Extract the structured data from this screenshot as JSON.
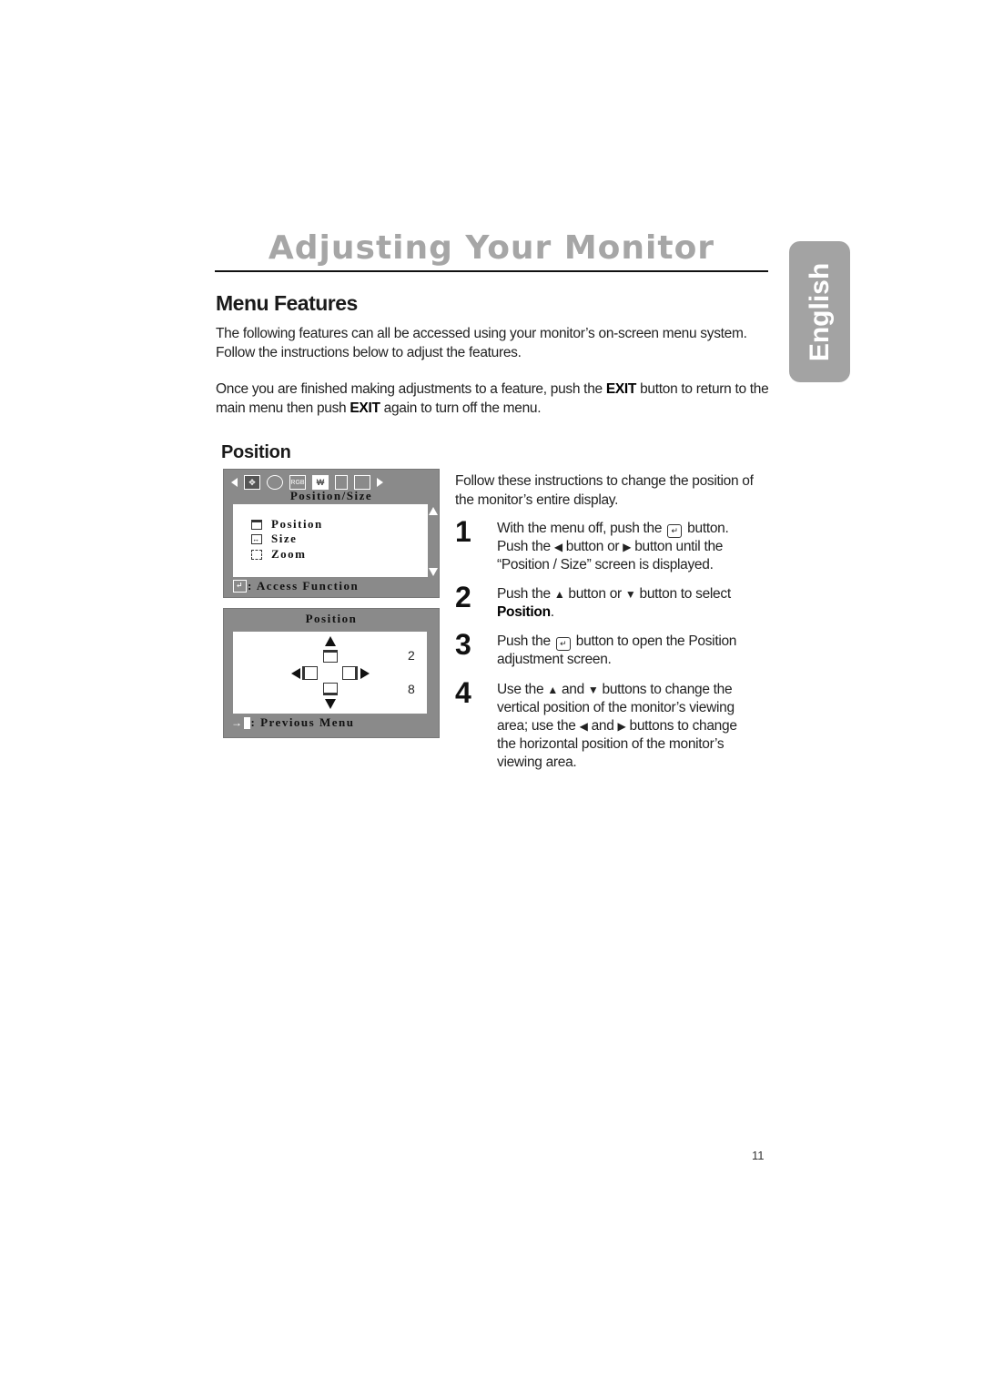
{
  "page": {
    "title": "Adjusting Your Monitor",
    "language_tab": "English",
    "section_title": "Menu Features",
    "intro": "The following features can all be accessed using your monitor’s on-screen menu system. Follow the instructions below to adjust the features.",
    "exit_note": {
      "part1": "Once you are finished making adjustments to a feature, push the ",
      "exit1": "EXIT",
      "part2": " button to return to the main menu then push ",
      "exit2": "EXIT",
      "part3": " again to turn off the menu."
    },
    "subsection_title": "Position",
    "page_number": "11"
  },
  "osd_menu": {
    "tab_icons": [
      "left-arrow-icon",
      "position-size-icon",
      "geometry-icon",
      "rgb-icon",
      "image-adjust-icon",
      "copy-icon",
      "window-icon",
      "right-arrow-icon"
    ],
    "rgb_label": "RGB",
    "header": "Position/Size",
    "items": [
      {
        "icon": "position-icon",
        "label": "Position"
      },
      {
        "icon": "size-icon",
        "label": "Size"
      },
      {
        "icon": "zoom-icon",
        "label": "Zoom"
      }
    ],
    "footer": ": Access Function"
  },
  "osd_position": {
    "header": "Position",
    "vertical_value": "2",
    "horizontal_value": "8",
    "footer": ": Previous Menu"
  },
  "instructions": {
    "lead": "Follow these instructions to change the position of the monitor’s entire display.",
    "steps": [
      {
        "number": "1",
        "line1a": "With the menu off, push the",
        "line1b": "button.",
        "line2a": "Push the",
        "line2b": "button or",
        "line2c": "button until the",
        "line3": "“Position / Size” screen is displayed."
      },
      {
        "number": "2",
        "line1a": "Push the",
        "line1b": "button or",
        "line1c": "button to select",
        "bold": "Position",
        "tail": "."
      },
      {
        "number": "3",
        "line1a": "Push the",
        "line1b": "button to open the Position",
        "line2": "adjustment screen."
      },
      {
        "number": "4",
        "line1a": "Use the",
        "line1b": "and",
        "line1c": "buttons to change the",
        "line2": "vertical position of the monitor’s viewing",
        "line3a": "area; use the",
        "line3b": "and",
        "line3c": "buttons to change",
        "line4": "the horizontal position of the monitor’s",
        "line5": "viewing area."
      }
    ]
  }
}
